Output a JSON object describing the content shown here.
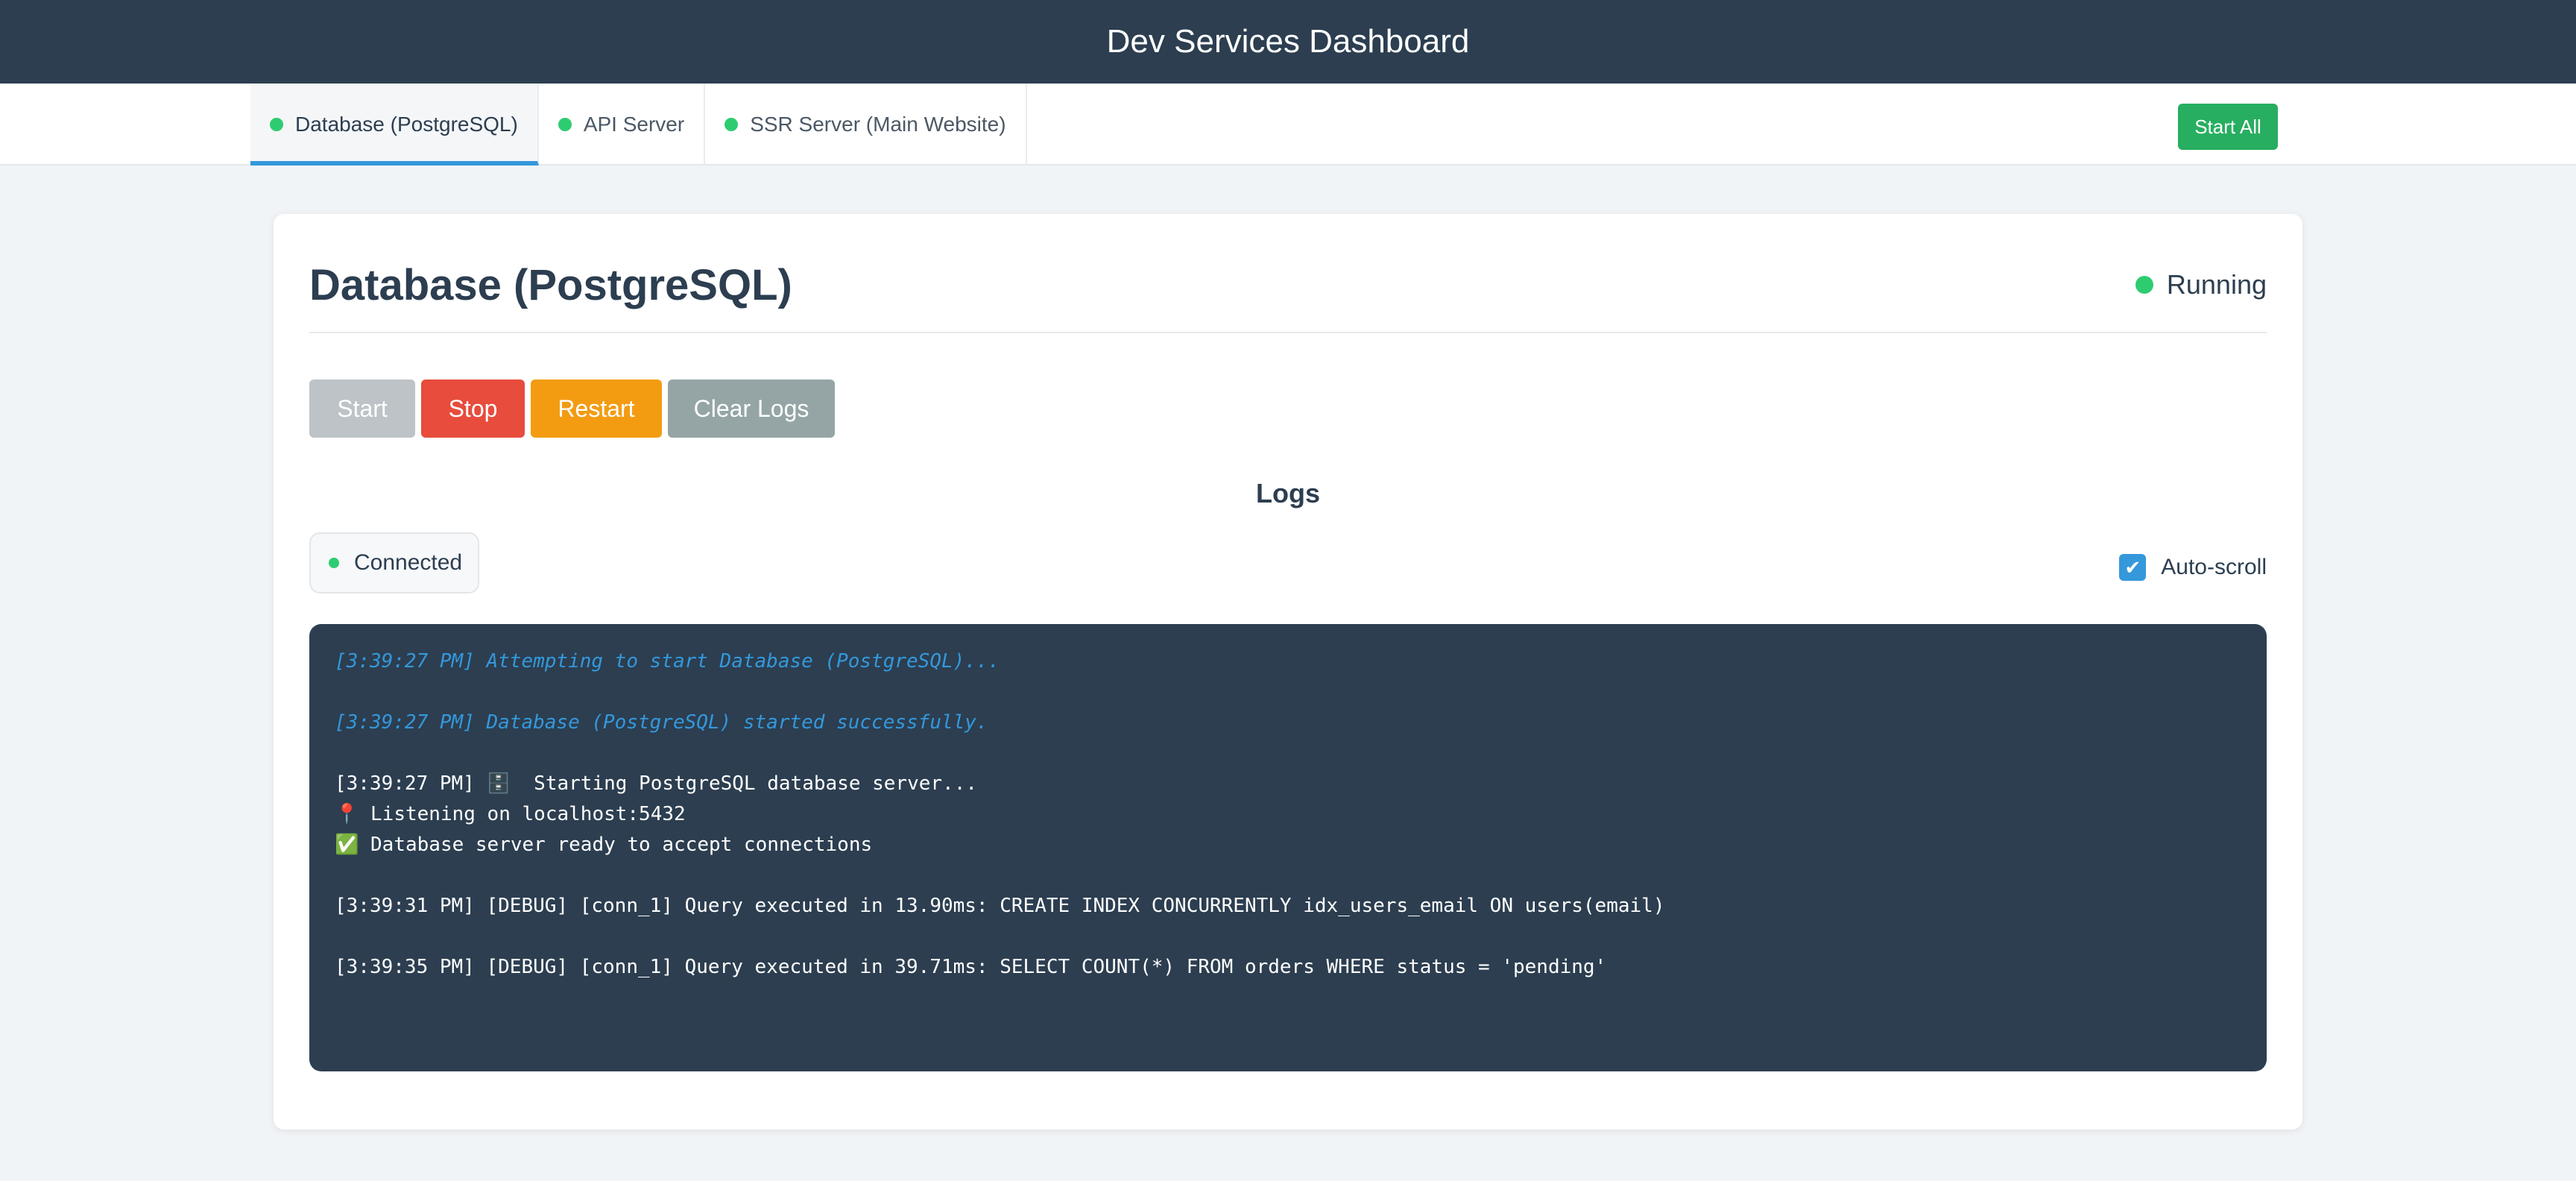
{
  "app": {
    "title": "Dev Services Dashboard"
  },
  "tabs": [
    {
      "label": "Database (PostgreSQL)",
      "status_color": "#2ecc71",
      "active": true
    },
    {
      "label": "API Server",
      "status_color": "#2ecc71",
      "active": false
    },
    {
      "label": "SSR Server (Main Website)",
      "status_color": "#2ecc71",
      "active": false
    }
  ],
  "toolbar": {
    "start_all_label": "Start All"
  },
  "service": {
    "title": "Database (PostgreSQL)",
    "status": "Running",
    "status_color": "#2ecc71"
  },
  "actions": {
    "start_label": "Start",
    "stop_label": "Stop",
    "restart_label": "Restart",
    "clear_logs_label": "Clear Logs"
  },
  "logs": {
    "title": "Logs",
    "connection_status": "Connected",
    "autoscroll_label": "Auto-scroll",
    "autoscroll_checked": true,
    "lines": [
      {
        "text": "[3:39:27 PM] Attempting to start Database (PostgreSQL)...",
        "kind": "system"
      },
      {
        "text": "[3:39:27 PM] Database (PostgreSQL) started successfully.",
        "kind": "system"
      },
      {
        "text": "[3:39:27 PM] 🗄️  Starting PostgreSQL database server...",
        "kind": "output"
      },
      {
        "text": "📍 Listening on localhost:5432",
        "kind": "output"
      },
      {
        "text": "✅ Database server ready to accept connections",
        "kind": "output"
      },
      {
        "text": "[3:39:31 PM] [DEBUG] [conn_1] Query executed in 13.90ms: CREATE INDEX CONCURRENTLY idx_users_email ON users(email)",
        "kind": "output"
      },
      {
        "text": "[3:39:35 PM] [DEBUG] [conn_1] Query executed in 39.71ms: SELECT COUNT(*) FROM orders WHERE status = 'pending'",
        "kind": "output"
      }
    ]
  },
  "colors": {
    "header_bg": "#2c3e50",
    "accent": "#3498db",
    "success": "#27ae60",
    "danger": "#e74c3c",
    "warning": "#f39c12",
    "muted": "#95a5a6",
    "disabled": "#bdc3c7"
  }
}
